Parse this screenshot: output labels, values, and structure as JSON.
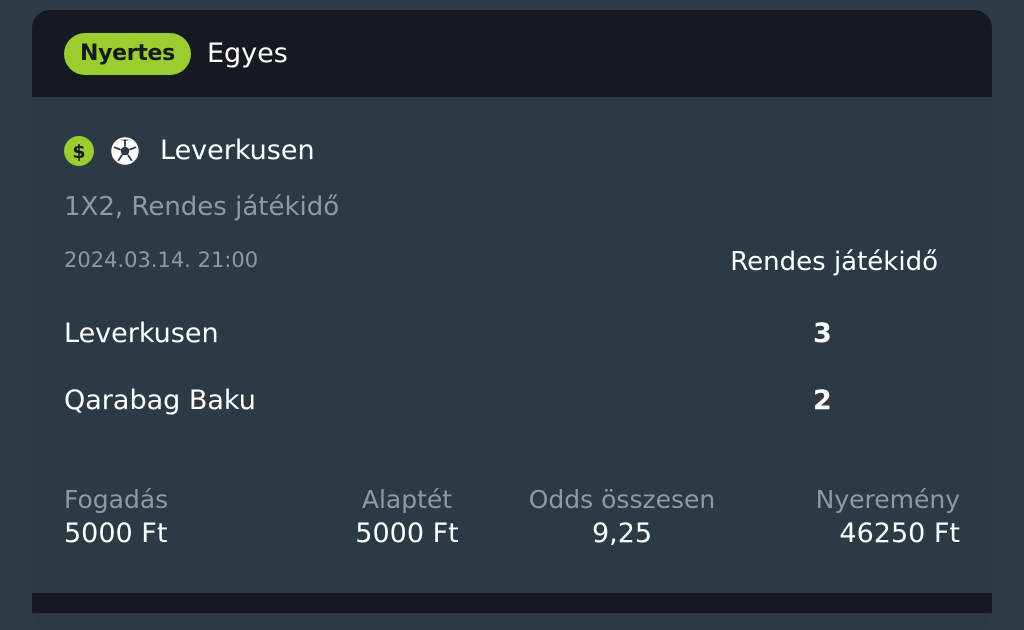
{
  "colors": {
    "page_bg": "#2e3c47",
    "card_bg": "#2b3a45",
    "header_bg": "#141a1f",
    "accent_green": "#9bcd2e",
    "muted_text": "#8e9aa3"
  },
  "header": {
    "status_badge": "Nyertes",
    "bet_type": "Egyes"
  },
  "event": {
    "icons": [
      "dollar-icon",
      "soccer-ball-icon"
    ],
    "name": "Leverkusen",
    "market": "1X2, Rendes játékidő",
    "datetime": "2024.03.14.  21:00",
    "period_label": "Rendes játékidő"
  },
  "teams": [
    {
      "name": "Leverkusen",
      "score": "3"
    },
    {
      "name": "Qarabag Baku",
      "score": "2"
    }
  ],
  "stats": {
    "stake": {
      "label": "Fogadás",
      "value": "5000 Ft"
    },
    "base_stake": {
      "label": "Alaptét",
      "value": "5000 Ft"
    },
    "total_odds": {
      "label": "Odds összesen",
      "value": "9,25"
    },
    "winnings": {
      "label": "Nyeremény",
      "value": "46250 Ft"
    }
  }
}
